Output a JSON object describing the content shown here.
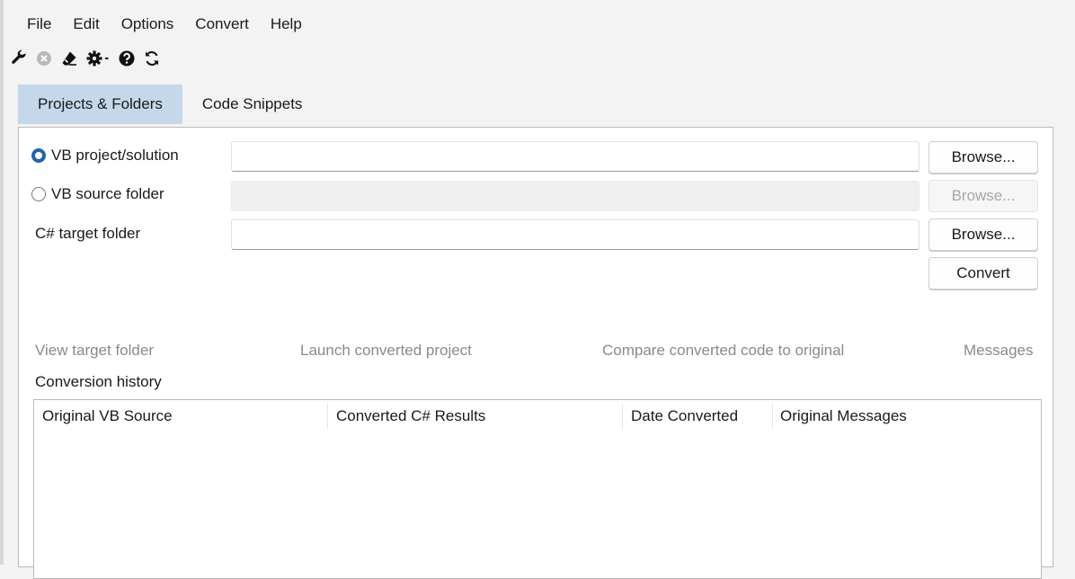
{
  "menu": [
    "File",
    "Edit",
    "Options",
    "Convert",
    "Help"
  ],
  "toolbar": {
    "icons": [
      "wrench-icon",
      "cancel-icon",
      "eraser-icon",
      "gear-dropdown-icon",
      "help-icon",
      "refresh-icon"
    ]
  },
  "tabs": [
    {
      "label": "Projects & Folders",
      "active": true
    },
    {
      "label": "Code Snippets",
      "active": false
    }
  ],
  "form": {
    "vb_project": {
      "label": "VB project/solution",
      "selected": true,
      "value": "",
      "browse": "Browse..."
    },
    "vb_folder": {
      "label": "VB source folder",
      "selected": false,
      "value": "",
      "browse": "Browse..."
    },
    "cs_target": {
      "label": "C# target folder",
      "value": "",
      "browse": "Browse..."
    },
    "convert_label": "Convert"
  },
  "actions": {
    "view_target": "View target folder",
    "launch": "Launch converted project",
    "compare": "Compare converted code to original",
    "messages": "Messages"
  },
  "history": {
    "label": "Conversion history",
    "columns": [
      "Original VB Source",
      "Converted C# Results",
      "Date Converted",
      "Original Messages"
    ],
    "rows": []
  },
  "colors": {
    "active_tab": "#c4d8ea",
    "radio_accent": "#1f62b5",
    "disabled_text": "#a8a8a8",
    "link_text": "#8a8a8a"
  }
}
